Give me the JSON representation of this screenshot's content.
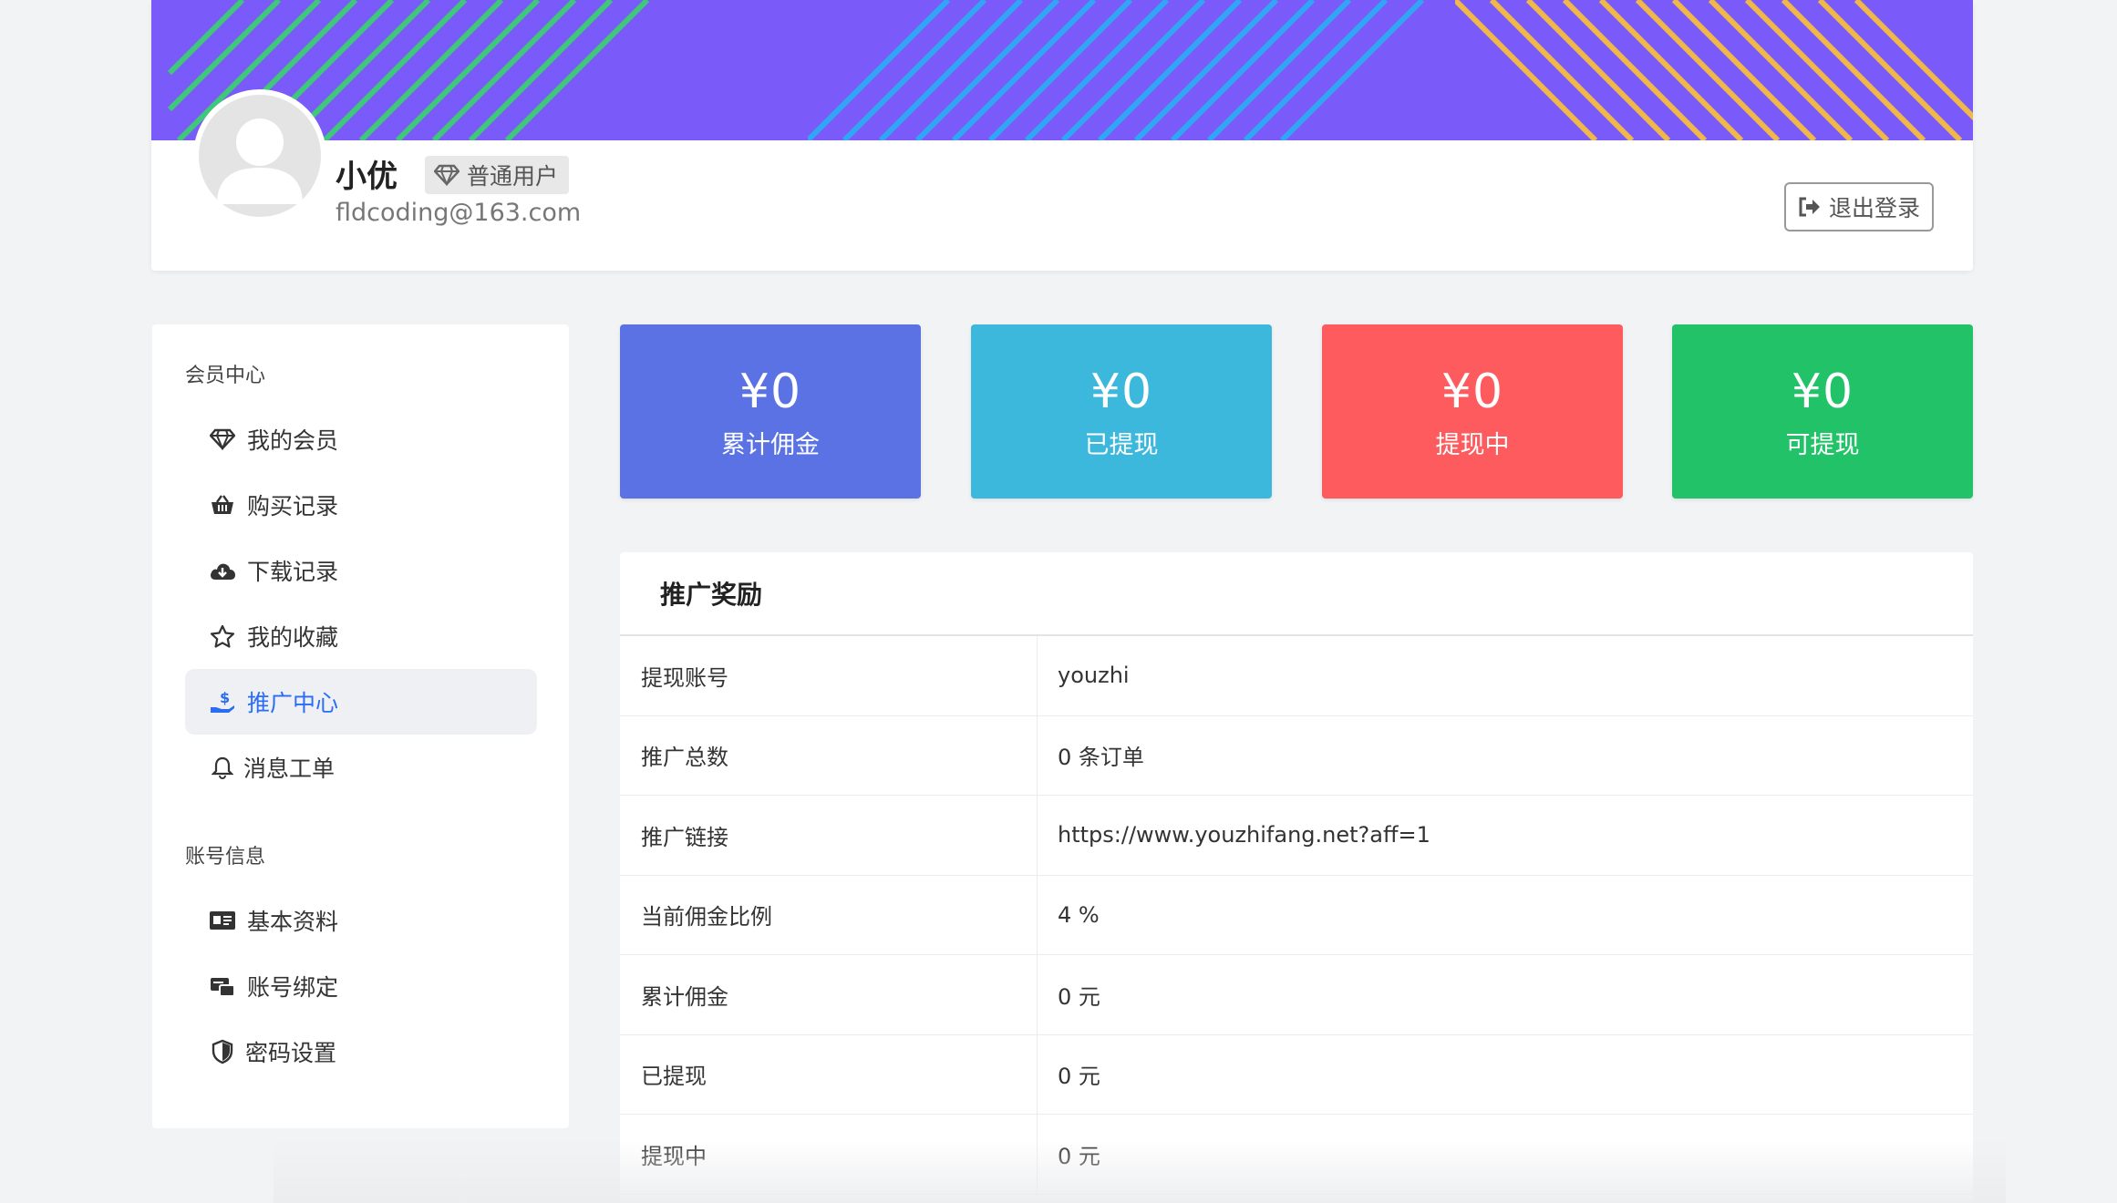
{
  "profile": {
    "name": "小优",
    "badge": "普通用户",
    "email": "fldcoding@163.com",
    "logout_label": "退出登录"
  },
  "sidebar": {
    "sections": [
      {
        "title": "会员中心",
        "items": [
          {
            "label": "我的会员",
            "icon": "diamond-icon"
          },
          {
            "label": "购买记录",
            "icon": "basket-icon"
          },
          {
            "label": "下载记录",
            "icon": "cloud-download-icon"
          },
          {
            "label": "我的收藏",
            "icon": "star-icon"
          },
          {
            "label": "推广中心",
            "icon": "hand-dollar-icon",
            "active": true
          },
          {
            "label": "消息工单",
            "icon": "bell-icon"
          }
        ]
      },
      {
        "title": "账号信息",
        "items": [
          {
            "label": "基本资料",
            "icon": "id-card-icon"
          },
          {
            "label": "账号绑定",
            "icon": "link-account-icon"
          },
          {
            "label": "密码设置",
            "icon": "shield-icon"
          }
        ]
      }
    ]
  },
  "stats": [
    {
      "amount": "¥0",
      "label": "累计佣金",
      "color": "#5a72e3"
    },
    {
      "amount": "¥0",
      "label": "已提现",
      "color": "#3cb8dd"
    },
    {
      "amount": "¥0",
      "label": "提现中",
      "color": "#fd5b5d"
    },
    {
      "amount": "¥0",
      "label": "可提现",
      "color": "#22c268"
    }
  ],
  "promotion": {
    "title": "推广奖励",
    "rows": [
      {
        "key": "提现账号",
        "value": "youzhi"
      },
      {
        "key": "推广总数",
        "value": "0 条订单"
      },
      {
        "key": "推广链接",
        "value": "https://www.youzhifang.net?aff=1"
      },
      {
        "key": "当前佣金比例",
        "value": "4 %"
      },
      {
        "key": "累计佣金",
        "value": "0 元"
      },
      {
        "key": "已提现",
        "value": "0 元"
      },
      {
        "key": "提现中",
        "value": "0 元"
      }
    ]
  },
  "colors": {
    "banner": "#7a5af8",
    "accent": "#2a6cf6"
  }
}
